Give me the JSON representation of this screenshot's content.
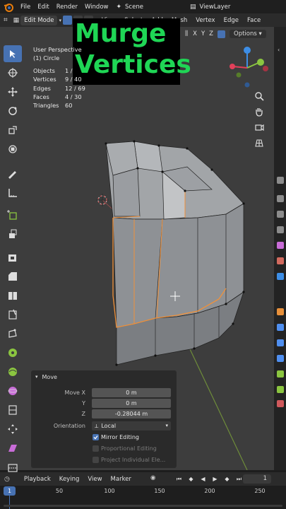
{
  "topbar": {
    "menus": [
      "File",
      "Edit",
      "Render",
      "Window"
    ],
    "scene": "Scene",
    "view_layer": "ViewLayer"
  },
  "header": {
    "mode": "Edit Mode",
    "menus": [
      "View",
      "Select",
      "Add",
      "Mesh",
      "Vertex",
      "Edge",
      "Face"
    ],
    "axes": [
      "X",
      "Y",
      "Z"
    ],
    "options": "Options"
  },
  "overlay_title": {
    "line1": "Murge",
    "line2": "Vertices"
  },
  "viewport": {
    "perspective": "User Perspective",
    "object_name": "(1) Circle",
    "stats": [
      {
        "label": "Objects",
        "value": "1 /"
      },
      {
        "label": "Vertices",
        "value": "9 / 40"
      },
      {
        "label": "Edges",
        "value": "12 / 69"
      },
      {
        "label": "Faces",
        "value": "4 / 30"
      },
      {
        "label": "Triangles",
        "value": "60"
      }
    ]
  },
  "operator_panel": {
    "title": "Move",
    "move_x_label": "Move X",
    "move_x": "0 m",
    "y_label": "Y",
    "y": "0 m",
    "z_label": "Z",
    "z": "-0.28044 m",
    "orientation_label": "Orientation",
    "orientation": "Local",
    "mirror_editing": "Mirror Editing",
    "proportional_editing": "Proportional Editing",
    "project_individual": "Project Individual Ele..."
  },
  "timeline": {
    "menus": [
      "Playback",
      "Keying",
      "View",
      "Marker"
    ],
    "current_frame": "1",
    "frame_field": "1",
    "ticks": [
      "50",
      "100",
      "150",
      "200",
      "250"
    ]
  },
  "colors": {
    "accent": "#4772b3",
    "overlay_text": "#1fd655",
    "selection": "#f0913a",
    "axis_x": "#e2405a",
    "axis_y": "#8bc540",
    "axis_z": "#3d8ee6"
  }
}
